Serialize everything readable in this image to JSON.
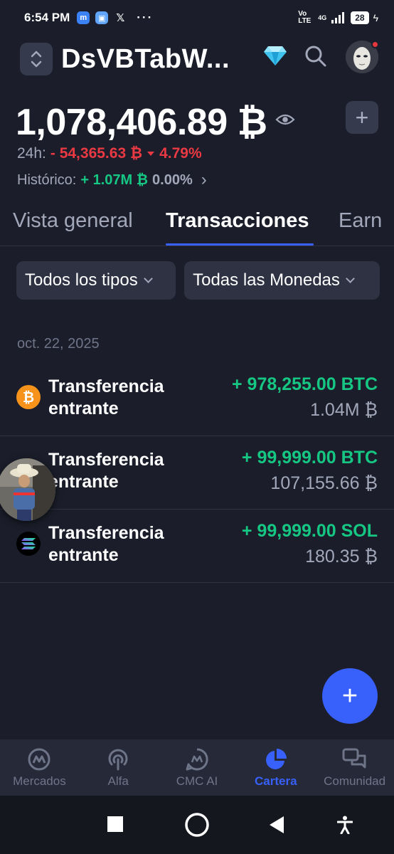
{
  "status_bar": {
    "time": "6:54 PM",
    "network_label": "Vo LTE",
    "signal_label": "4G",
    "battery": "28",
    "dots": "···"
  },
  "header": {
    "wallet_name": "DsVBTabW...",
    "icons": [
      "chevron-up-down-icon",
      "diamond-icon",
      "search-icon",
      "avatar-mask-icon"
    ]
  },
  "balance": {
    "amount": "1,078,406.89 ₿",
    "add_symbol": "+",
    "change_24h_label": "24h:",
    "change_24h_value": "- 54,365.63 ₿",
    "change_24h_percent": "4.79%",
    "historic_label": "Histórico:",
    "historic_value": "+ 1.07M ₿",
    "historic_percent": "0.00%",
    "historic_arrow": "›"
  },
  "tabs": [
    {
      "label": "Vista general",
      "active": false
    },
    {
      "label": "Transacciones",
      "active": true
    },
    {
      "label": "Earn",
      "active": false
    }
  ],
  "filters": {
    "types": "Todos los tipos",
    "coins": "Todas las Monedas"
  },
  "date_header": "oct. 22, 2025",
  "transactions": [
    {
      "title_line1": "Transferencia",
      "title_line2": "entrante",
      "amount": "+ 978,255.00 BTC",
      "value": "1.04M ₿",
      "icon": "bitcoin-icon"
    },
    {
      "title_line1": "Transferencia",
      "title_line2": "entrante",
      "amount": "+ 99,999.00 BTC",
      "value": "107,155.66 ₿",
      "icon": "bitcoin-icon"
    },
    {
      "title_line1": "Transferencia",
      "title_line2": "entrante",
      "amount": "+ 99,999.00 SOL",
      "value": "180.35 ₿",
      "icon": "solana-icon"
    }
  ],
  "fab_symbol": "+",
  "bottom_nav": [
    {
      "label": "Mercados",
      "active": false
    },
    {
      "label": "Alfa",
      "active": false
    },
    {
      "label": "CMC AI",
      "active": false
    },
    {
      "label": "Cartera",
      "active": true
    },
    {
      "label": "Comunidad",
      "active": false
    }
  ],
  "colors": {
    "background": "#1b1e2a",
    "accent": "#3861fb",
    "positive": "#16c784",
    "negative": "#ea3943",
    "muted": "#a2a8ba"
  }
}
